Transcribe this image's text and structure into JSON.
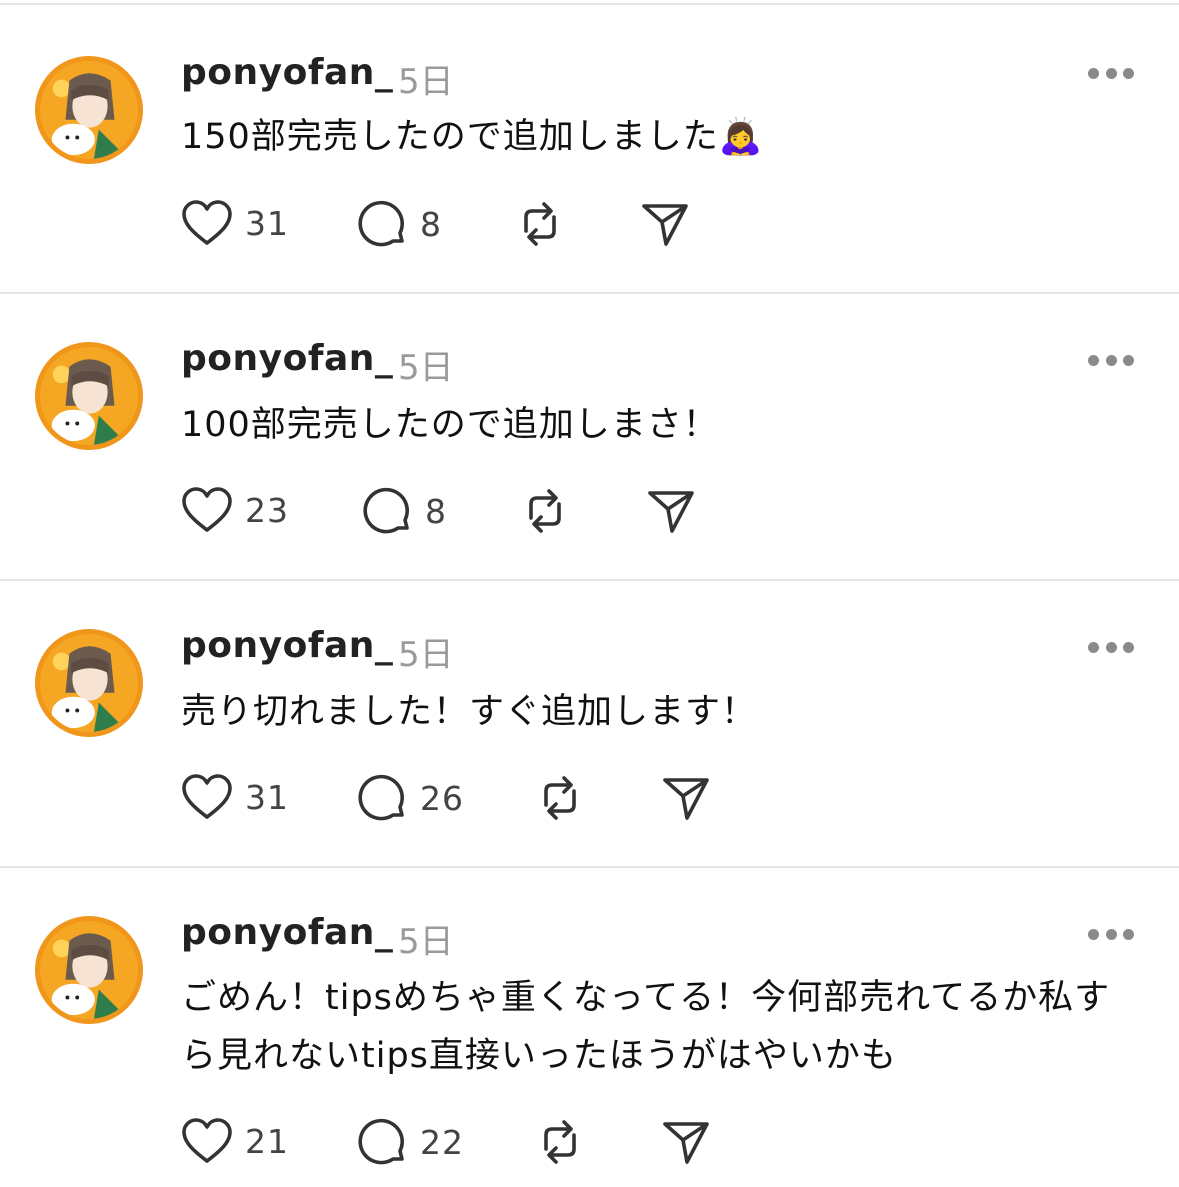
{
  "posts": [
    {
      "username": "ponyofan_",
      "time": "5日",
      "text": "150部完売したので追加しました",
      "emoji": "🙇‍♀️",
      "likes": "31",
      "replies": "8"
    },
    {
      "username": "ponyofan_",
      "time": "5日",
      "text": "100部完売したので追加しまさ！",
      "emoji": "",
      "likes": "23",
      "replies": "8"
    },
    {
      "username": "ponyofan_",
      "time": "5日",
      "text": "売り切れました！すぐ追加します！",
      "emoji": "",
      "likes": "31",
      "replies": "26"
    },
    {
      "username": "ponyofan_",
      "time": "5日",
      "text": "ごめん！tipsめちゃ重くなってる！今何部売れてるか私すら見れないtips直接いったほうがはやいかも",
      "emoji": "",
      "likes": "21",
      "replies": "22"
    }
  ],
  "icons": {
    "like": "heart-icon",
    "reply": "speech-bubble-icon",
    "repost": "repost-icon",
    "share": "paper-plane-icon",
    "more": "more-horizontal-icon"
  },
  "colors": {
    "avatar_ring": "#f0961a",
    "text": "#111111",
    "muted": "#9a9a9a",
    "divider": "#e6e6e6"
  }
}
